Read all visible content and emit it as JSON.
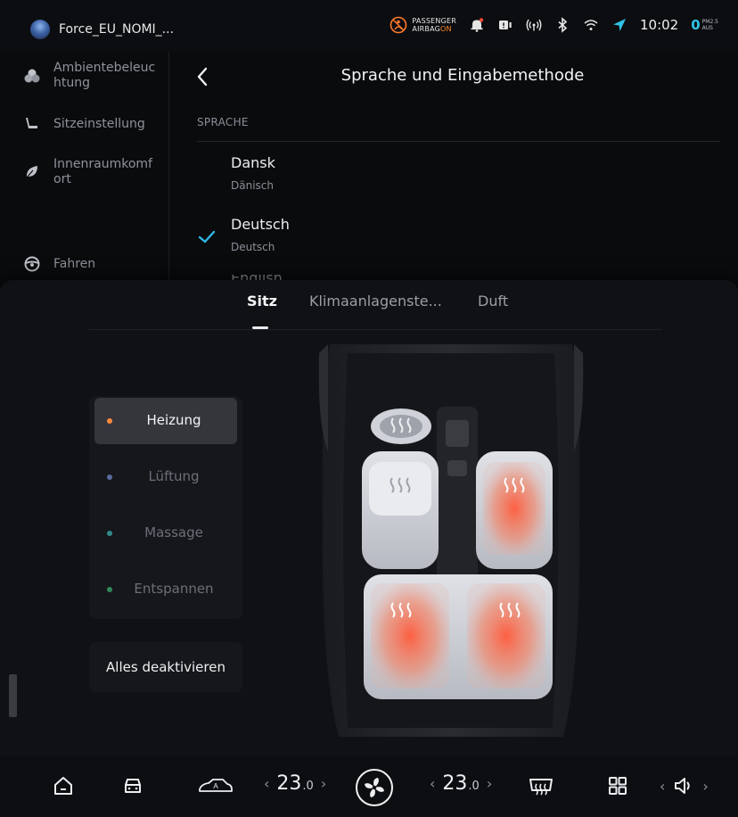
{
  "status_bar": {
    "user": "Force_EU_NOMI_...",
    "airbag_line1": "PASSENGER",
    "airbag_line2": "AIRBAG",
    "airbag_state": "ON",
    "time": "10:02",
    "pm_value": "0",
    "pm_label_top": "PM2.5",
    "pm_label_bottom": "AUS",
    "accent_color": "#2ec4e6"
  },
  "sidebar": {
    "items": [
      {
        "label": "Ambientebeleuc htung",
        "icon": "ambient-light-icon"
      },
      {
        "label": "Sitzeinstellung",
        "icon": "seat-icon"
      },
      {
        "label": "Innenraumkomf ort",
        "icon": "leaf-icon"
      },
      {
        "label": "Fahren",
        "icon": "steering-wheel-icon"
      }
    ]
  },
  "language_panel": {
    "title": "Sprache und Eingabemethode",
    "section": "SPRACHE",
    "languages": [
      {
        "name": "Dansk",
        "sub": "Dänisch",
        "selected": false
      },
      {
        "name": "Deutsch",
        "sub": "Deutsch",
        "selected": true
      }
    ],
    "peek": "English",
    "check_color": "#2fb8e6"
  },
  "overlay": {
    "tabs": [
      {
        "label": "Sitz",
        "active": true
      },
      {
        "label": "Klimaanlagenste...",
        "active": false
      },
      {
        "label": "Duft",
        "active": false
      }
    ],
    "modes": [
      {
        "label": "Heizung",
        "dot_color": "#ff8a3d",
        "active": true
      },
      {
        "label": "Lüftung",
        "dot_color": "#5a6aa0",
        "active": false
      },
      {
        "label": "Massage",
        "dot_color": "#2f8a8a",
        "active": false
      },
      {
        "label": "Entspannen",
        "dot_color": "#2f8a58",
        "active": false
      }
    ],
    "deactivate_label": "Alles deaktivieren",
    "heated_seats": [
      "front-right",
      "rear-left",
      "rear-right"
    ]
  },
  "dock": {
    "temp_left": "23",
    "temp_left_dec": ".0",
    "temp_right": "23",
    "temp_right_dec": ".0",
    "chev_left": "‹",
    "chev_right": "›"
  }
}
